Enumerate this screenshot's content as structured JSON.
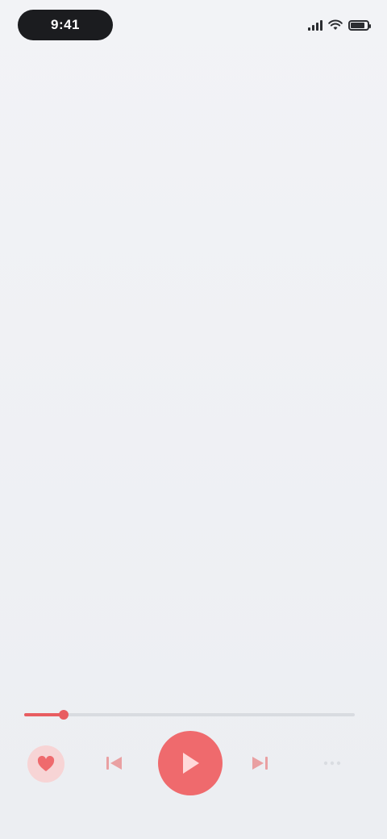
{
  "status_bar": {
    "time": "9:41",
    "battery_level": 0.85
  },
  "header": {
    "subtitle": ""
  },
  "lyrics": {
    "lines": [
      "",
      "",
      "",
      "",
      "",
      "",
      "",
      "",
      "",
      "",
      "",
      "",
      "",
      "",
      "",
      "",
      "",
      "",
      "",
      "",
      "",
      "",
      "",
      ""
    ]
  },
  "player": {
    "elapsed": "",
    "progress": 0.12
  },
  "colors": {
    "accent": "#ef6a6d",
    "accent_light": "#f7d4d5"
  },
  "icons": {
    "like": "heart-icon",
    "prev": "skip-previous-icon",
    "play": "play-icon",
    "next": "skip-next-icon",
    "more": "more-icon"
  }
}
